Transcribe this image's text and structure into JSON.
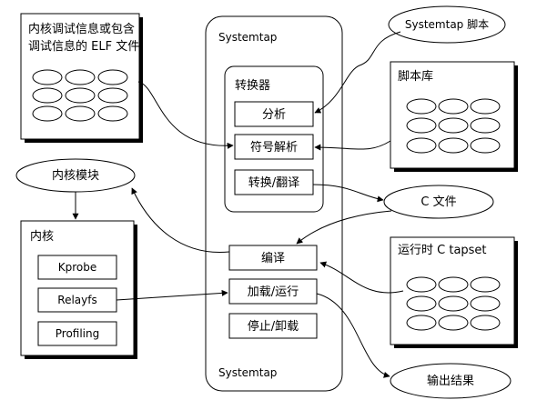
{
  "elf_box": {
    "label_line1": "内核调试信息或包含",
    "label_line2": "调试信息的 ELF 文件"
  },
  "systemtap": {
    "title_top": "Systemtap",
    "title_bottom": "Systemtap"
  },
  "translator": {
    "title": "转换器",
    "items": [
      "分析",
      "符号解析",
      "转换/翻译"
    ]
  },
  "compile": {
    "label": "编译"
  },
  "load_run": {
    "label": "加载/运行"
  },
  "stop_unload": {
    "label": "停止/卸载"
  },
  "systemtap_script": {
    "label": "Systemtap 脚本"
  },
  "script_lib": {
    "title": "脚本库"
  },
  "kernel_module": {
    "label": "内核模块"
  },
  "c_file": {
    "label": "C 文件"
  },
  "kernel": {
    "title": "内核",
    "items": [
      "Kprobe",
      "Relayfs",
      "Profiling"
    ]
  },
  "runtime_tapset": {
    "title": "运行时 C tapset"
  },
  "output": {
    "label": "输出结果"
  }
}
